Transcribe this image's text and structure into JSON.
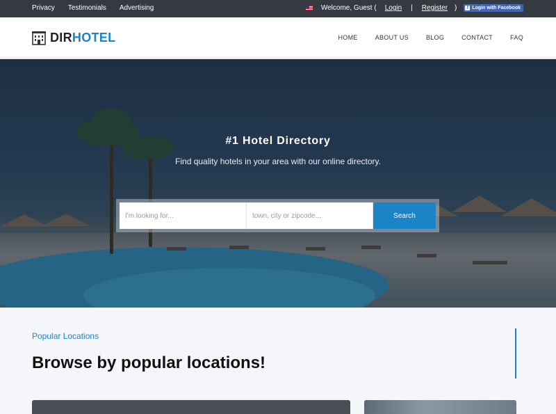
{
  "topbar": {
    "links": [
      "Privacy",
      "Testimonials",
      "Advertising"
    ],
    "welcome": "Welcome, Guest (",
    "login": "Login",
    "separator": "|",
    "register": "Register",
    "close_paren": ")",
    "facebook_btn": "Login with Facebook"
  },
  "header": {
    "logo_part1": "DIR",
    "logo_part2": "HOTEL",
    "nav": [
      "HOME",
      "ABOUT US",
      "BLOG",
      "CONTACT",
      "FAQ"
    ]
  },
  "hero": {
    "title": "#1 Hotel Directory",
    "subtitle": "Find quality hotels in your area with our online directory.",
    "search": {
      "keyword_placeholder": "I'm looking for...",
      "location_placeholder": "town, city or zipcode...",
      "button_label": "Search"
    }
  },
  "popular": {
    "kicker": "Popular Locations",
    "title": "Browse by popular locations!"
  },
  "colors": {
    "accent": "#1a84c7",
    "topbar": "#343a40",
    "facebook": "#4267b2"
  }
}
